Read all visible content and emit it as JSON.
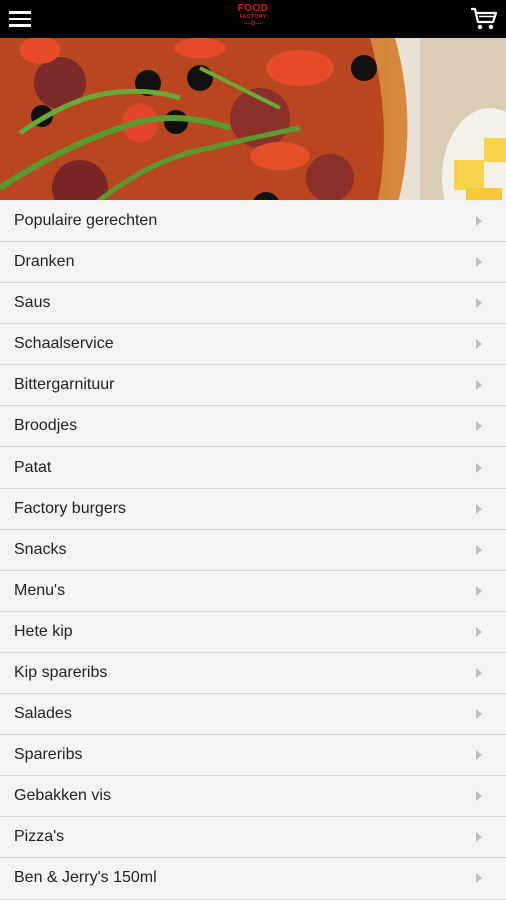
{
  "header": {
    "logo": {
      "line1": "FOOD",
      "line2": "FACTORY",
      "line3": "—⊙—"
    }
  },
  "categories": [
    "Populaire gerechten",
    "Dranken",
    "Saus",
    "Schaalservice",
    "Bittergarnituur",
    "Broodjes",
    "Patat",
    "Factory burgers",
    "Snacks",
    "Menu's",
    "Hete kip",
    "Kip spareribs",
    "Salades",
    "Spareribs",
    "Gebakken vis",
    "Pizza's",
    "Ben & Jerry's 150ml"
  ]
}
